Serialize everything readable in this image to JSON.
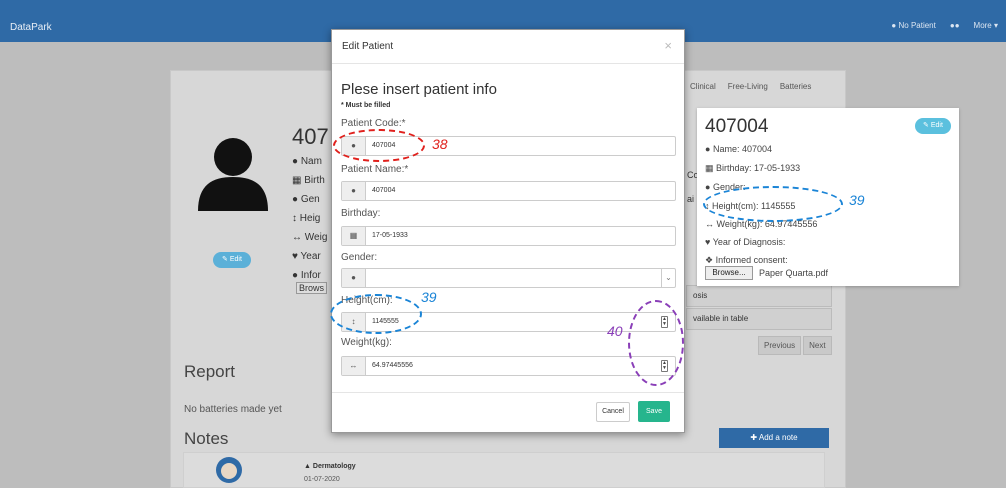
{
  "navbar": {
    "brand": "DataPark",
    "patient_label": "No Patient",
    "more_label": "More ▾"
  },
  "background": {
    "patient_code": "407",
    "list": [
      "Nam",
      "Birth",
      "Gen",
      "Heig",
      "Weig",
      "Year",
      "Infor"
    ],
    "edit_label": "Edit",
    "browse_fragment": "Brows",
    "report_title": "Report",
    "no_batteries": "No batteries made yet",
    "notes_title": "Notes",
    "add_note": "Add a note",
    "note_title": "Dermatology",
    "note_date": "01-07-2020",
    "tabs": [
      "Clinical",
      "Free-Living",
      "Batteries"
    ],
    "row1": "osis",
    "row2": "vailable in table",
    "pager": [
      "Previous",
      "Next"
    ],
    "frag_co": "Co",
    "frag_ai": "ai"
  },
  "modal": {
    "title": "Edit Patient",
    "close": "×",
    "heading": "Plese insert patient info",
    "must": "* Must be filled",
    "fields": {
      "code": {
        "label": "Patient Code:*",
        "value": "407004"
      },
      "name": {
        "label": "Patient Name:*",
        "value": "407004"
      },
      "birthday": {
        "label": "Birthday:",
        "value": "17-05-1933"
      },
      "gender": {
        "label": "Gender:",
        "value": ""
      },
      "height": {
        "label": "Height(cm):",
        "value": "1145555"
      },
      "weight": {
        "label": "Weight(kg):",
        "value": "64.97445556"
      }
    },
    "cancel": "Cancel",
    "save": "Save"
  },
  "card": {
    "title": "407004",
    "edit": "Edit",
    "name": "Name: 407004",
    "birthday": "Birthday: 17-05-1933",
    "gender": "Gender:",
    "height": "Height(cm): 1145555",
    "weight": "Weight(kg): 64.97445556",
    "diagnosis": "Year of Diagnosis:",
    "consent": "Informed consent:",
    "browse": "Browse...",
    "file": "Paper Quarta.pdf"
  },
  "annotations": {
    "a38": "38",
    "a39_left": "39",
    "a39_right": "39",
    "a40": "40"
  },
  "colors": {
    "navbar": "#2f6aa6",
    "save": "#26b58d",
    "edit": "#5bc0de",
    "ann_red": "#e0201c",
    "ann_blue": "#1a84d6",
    "ann_purple": "#8a3fb8"
  }
}
